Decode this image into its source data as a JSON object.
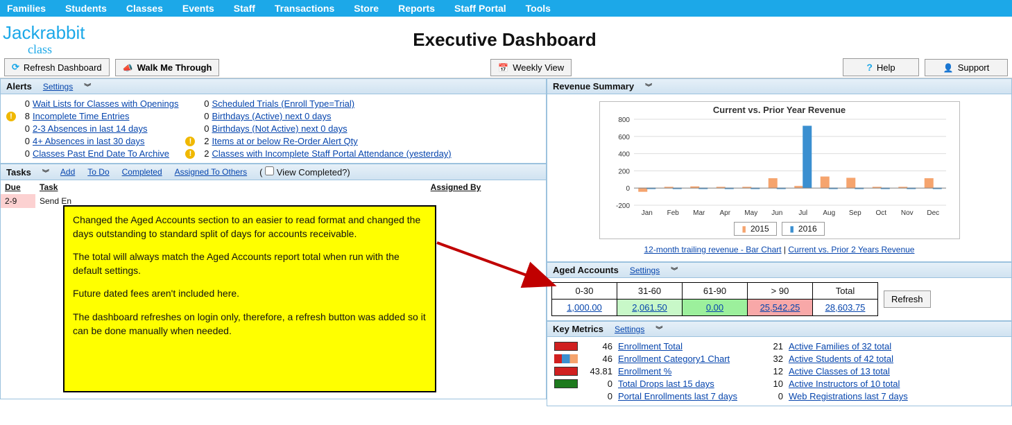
{
  "nav": {
    "items": [
      "Families",
      "Students",
      "Classes",
      "Events",
      "Staff",
      "Transactions",
      "Store",
      "Reports",
      "Staff Portal",
      "Tools"
    ]
  },
  "logo": {
    "top": "Jackrabbit",
    "bottom": "class"
  },
  "page_title": "Executive Dashboard",
  "toolbar": {
    "refresh": "Refresh Dashboard",
    "walkme": "Walk Me Through",
    "weekly": "Weekly View",
    "help": "Help",
    "support": "Support"
  },
  "alerts": {
    "title": "Alerts",
    "settings": "Settings",
    "left": [
      {
        "warn": false,
        "count": 0,
        "label": "Wait Lists for Classes with Openings"
      },
      {
        "warn": true,
        "count": 8,
        "label": "Incomplete Time Entries"
      },
      {
        "warn": false,
        "count": 0,
        "label": "2-3 Absences in last 14 days"
      },
      {
        "warn": false,
        "count": 0,
        "label": "4+ Absences in last 30 days"
      },
      {
        "warn": false,
        "count": 0,
        "label": "Classes Past End Date To Archive"
      }
    ],
    "right": [
      {
        "warn": false,
        "count": 0,
        "label": "Scheduled Trials (Enroll Type=Trial)"
      },
      {
        "warn": false,
        "count": 0,
        "label": "Birthdays (Active) next 0 days"
      },
      {
        "warn": false,
        "count": 0,
        "label": "Birthdays (Not Active) next 0 days"
      },
      {
        "warn": true,
        "count": 2,
        "label": "Items at or below Re-Order Alert Qty"
      },
      {
        "warn": true,
        "count": 2,
        "label": "Classes with Incomplete Staff Portal Attendance (yesterday)"
      }
    ]
  },
  "tasks": {
    "title": "Tasks",
    "add": "Add",
    "todo": "To Do",
    "completed": "Completed",
    "assigned": "Assigned To Others",
    "view_completed": "View Completed?",
    "headers": {
      "due": "Due",
      "task": "Task",
      "assigned_by": "Assigned By"
    },
    "rows": [
      {
        "due": "2-9",
        "task": "Send En"
      }
    ]
  },
  "callout": {
    "p1": "Changed the Aged Accounts section to an easier to read format and changed the days outstanding to standard split of days for accounts receivable.",
    "p2": "The total will always match the Aged Accounts report total when run with the default settings.",
    "p3": "Future dated fees aren't included here.",
    "p4": "The dashboard refreshes on login only, therefore, a refresh button was added so it can be done manually when needed."
  },
  "revenue": {
    "title": "Revenue Summary",
    "link1": "12-month trailing revenue - Bar Chart",
    "link2": "Current vs. Prior 2 Years Revenue"
  },
  "chart_data": {
    "type": "bar",
    "title": "Current vs. Prior Year Revenue",
    "categories": [
      "Jan",
      "Feb",
      "Mar",
      "Apr",
      "May",
      "Jun",
      "Jul",
      "Aug",
      "Sep",
      "Oct",
      "Nov",
      "Dec"
    ],
    "ylim": [
      -200,
      800
    ],
    "yticks": [
      -200,
      0,
      200,
      400,
      600,
      800
    ],
    "series": [
      {
        "name": "2015",
        "color": "#F5A46E",
        "values": [
          -40,
          10,
          15,
          10,
          10,
          110,
          20,
          130,
          115,
          10,
          10,
          110
        ]
      },
      {
        "name": "2016",
        "color": "#3B8FD0",
        "values": [
          0,
          0,
          0,
          0,
          0,
          0,
          720,
          0,
          0,
          0,
          0,
          0
        ]
      }
    ]
  },
  "aged": {
    "title": "Aged Accounts",
    "settings": "Settings",
    "headers": [
      "0-30",
      "31-60",
      "61-90",
      "> 90",
      "Total"
    ],
    "values": [
      "1,000.00",
      "2,061.50",
      "0.00",
      "25,542.25",
      "28,603.75"
    ],
    "refresh": "Refresh"
  },
  "metrics": {
    "title": "Key Metrics",
    "settings": "Settings",
    "left": [
      {
        "color": "#D02020",
        "val": "46",
        "label": "Enrollment Total"
      },
      {
        "color": "chart",
        "val": "46",
        "label": "Enrollment Category1 Chart"
      },
      {
        "color": "#D02020",
        "val": "43.81",
        "label": "Enrollment %"
      },
      {
        "color": "#1E7A1E",
        "val": "0",
        "label": "Total Drops last 15 days"
      },
      {
        "color": "",
        "val": "0",
        "label": "Portal Enrollments last 7 days"
      }
    ],
    "right": [
      {
        "val": "21",
        "label": "Active Families of 32 total"
      },
      {
        "val": "32",
        "label": "Active Students of 42 total"
      },
      {
        "val": "12",
        "label": "Active Classes of 13 total"
      },
      {
        "val": "10",
        "label": "Active Instructors of 10 total"
      },
      {
        "val": "0",
        "label": "Web Registrations last 7 days"
      }
    ]
  }
}
